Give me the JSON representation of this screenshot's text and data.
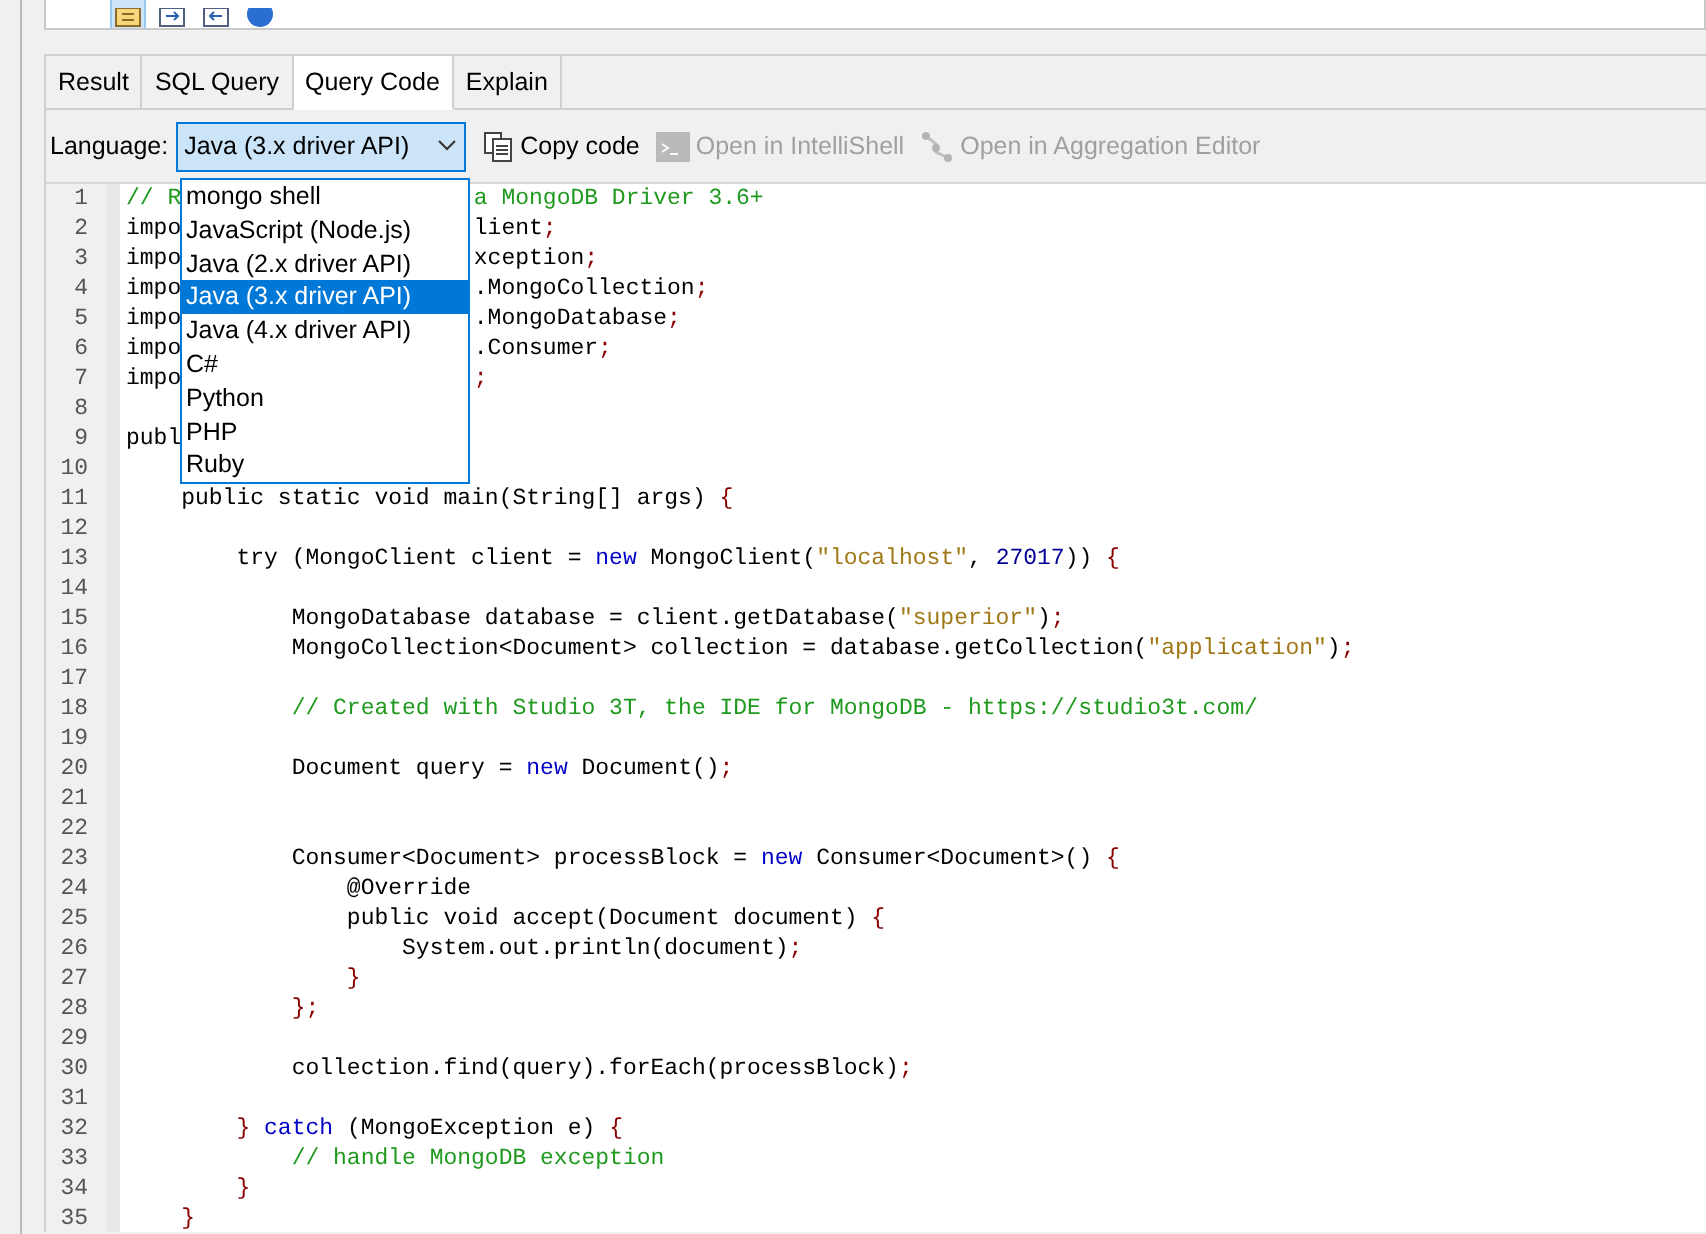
{
  "top_toolbar": {
    "buttons": [
      {
        "selected": true
      },
      {
        "selected": false
      },
      {
        "selected": false
      },
      {
        "selected": false
      }
    ]
  },
  "tabs": [
    {
      "label": "Result",
      "selected": false
    },
    {
      "label": "SQL Query",
      "selected": false
    },
    {
      "label": "Query Code",
      "selected": true
    },
    {
      "label": "Explain",
      "selected": false
    }
  ],
  "language": {
    "label": "Language:",
    "value": "Java (3.x driver API)",
    "expanded": true,
    "options": [
      {
        "label": "mongo shell",
        "selected": false
      },
      {
        "label": "JavaScript (Node.js)",
        "selected": false
      },
      {
        "label": "Java (2.x driver API)",
        "selected": false
      },
      {
        "label": "Java (3.x driver API)",
        "selected": true
      },
      {
        "label": "Java (4.x driver API)",
        "selected": false
      },
      {
        "label": "C#",
        "selected": false
      },
      {
        "label": "Python",
        "selected": false
      },
      {
        "label": "PHP",
        "selected": false
      },
      {
        "label": "Ruby",
        "selected": false
      }
    ]
  },
  "actions": [
    {
      "label": "Copy code",
      "disabled": false
    },
    {
      "label": "Open in IntelliShell",
      "disabled": true
    },
    {
      "label": "Open in Aggregation Editor",
      "disabled": true
    }
  ],
  "code": [
    {
      "number": "1",
      "tokens": [
        {
          "kind": "comment",
          "text": "// R"
        }
      ],
      "right": [
        {
          "kind": "comment",
          "text": "a MongoDB Driver 3.6+"
        }
      ]
    },
    {
      "number": "2",
      "tokens": [
        {
          "kind": "plain",
          "text": "impo"
        }
      ],
      "right": [
        {
          "kind": "plain",
          "text": "lient"
        },
        {
          "kind": "punct",
          "text": ";"
        }
      ]
    },
    {
      "number": "3",
      "tokens": [
        {
          "kind": "plain",
          "text": "impo"
        }
      ],
      "right": [
        {
          "kind": "plain",
          "text": "xception"
        },
        {
          "kind": "punct",
          "text": ";"
        }
      ]
    },
    {
      "number": "4",
      "tokens": [
        {
          "kind": "plain",
          "text": "impo"
        }
      ],
      "right": [
        {
          "kind": "plain",
          "text": ".MongoCollection"
        },
        {
          "kind": "punct",
          "text": ";"
        }
      ]
    },
    {
      "number": "5",
      "tokens": [
        {
          "kind": "plain",
          "text": "impo"
        }
      ],
      "right": [
        {
          "kind": "plain",
          "text": ".MongoDatabase"
        },
        {
          "kind": "punct",
          "text": ";"
        }
      ]
    },
    {
      "number": "6",
      "tokens": [
        {
          "kind": "plain",
          "text": "impo"
        }
      ],
      "right": [
        {
          "kind": "plain",
          "text": ".Consumer"
        },
        {
          "kind": "punct",
          "text": ";"
        }
      ]
    },
    {
      "number": "7",
      "tokens": [
        {
          "kind": "plain",
          "text": "impo"
        }
      ],
      "right": [
        {
          "kind": "punct",
          "text": ";"
        }
      ]
    },
    {
      "number": "8"
    },
    {
      "number": "9",
      "tokens": [
        {
          "kind": "plain",
          "text": "publ"
        }
      ]
    },
    {
      "number": "10"
    },
    {
      "number": "11",
      "tokens": [
        {
          "kind": "plain",
          "text": "    public static void main(String[] args) "
        },
        {
          "kind": "punct",
          "text": "{"
        }
      ]
    },
    {
      "number": "12"
    },
    {
      "number": "13",
      "tokens": [
        {
          "kind": "plain",
          "text": "        try (MongoClient client = "
        },
        {
          "kind": "keyword",
          "text": "new"
        },
        {
          "kind": "plain",
          "text": " MongoClient("
        },
        {
          "kind": "string",
          "text": "\"localhost\""
        },
        {
          "kind": "plain",
          "text": ", "
        },
        {
          "kind": "number",
          "text": "27017"
        },
        {
          "kind": "plain",
          "text": ")) "
        },
        {
          "kind": "punct",
          "text": "{"
        }
      ]
    },
    {
      "number": "14"
    },
    {
      "number": "15",
      "tokens": [
        {
          "kind": "plain",
          "text": "            MongoDatabase database = client.getDatabase("
        },
        {
          "kind": "string",
          "text": "\"superior\""
        },
        {
          "kind": "plain",
          "text": ")"
        },
        {
          "kind": "punct",
          "text": ";"
        }
      ]
    },
    {
      "number": "16",
      "tokens": [
        {
          "kind": "plain",
          "text": "            MongoCollection<Document> collection = database.getCollection("
        },
        {
          "kind": "string",
          "text": "\"application\""
        },
        {
          "kind": "plain",
          "text": ")"
        },
        {
          "kind": "punct",
          "text": ";"
        }
      ]
    },
    {
      "number": "17"
    },
    {
      "number": "18",
      "tokens": [
        {
          "kind": "comment",
          "text": "            // Created with Studio 3T, the IDE for MongoDB - https://studio3t.com/"
        }
      ]
    },
    {
      "number": "19"
    },
    {
      "number": "20",
      "tokens": [
        {
          "kind": "plain",
          "text": "            Document query = "
        },
        {
          "kind": "keyword",
          "text": "new"
        },
        {
          "kind": "plain",
          "text": " Document()"
        },
        {
          "kind": "punct",
          "text": ";"
        }
      ]
    },
    {
      "number": "21"
    },
    {
      "number": "22"
    },
    {
      "number": "23",
      "tokens": [
        {
          "kind": "plain",
          "text": "            Consumer<Document> processBlock = "
        },
        {
          "kind": "keyword",
          "text": "new"
        },
        {
          "kind": "plain",
          "text": " Consumer<Document>() "
        },
        {
          "kind": "punct",
          "text": "{"
        }
      ]
    },
    {
      "number": "24",
      "tokens": [
        {
          "kind": "plain",
          "text": "                @Override"
        }
      ]
    },
    {
      "number": "25",
      "tokens": [
        {
          "kind": "plain",
          "text": "                public void accept(Document document) "
        },
        {
          "kind": "punct",
          "text": "{"
        }
      ]
    },
    {
      "number": "26",
      "tokens": [
        {
          "kind": "plain",
          "text": "                    System.out.println(document)"
        },
        {
          "kind": "punct",
          "text": ";"
        }
      ]
    },
    {
      "number": "27",
      "tokens": [
        {
          "kind": "punct",
          "text": "                }"
        }
      ]
    },
    {
      "number": "28",
      "tokens": [
        {
          "kind": "punct",
          "text": "            };"
        }
      ]
    },
    {
      "number": "29"
    },
    {
      "number": "30",
      "tokens": [
        {
          "kind": "plain",
          "text": "            collection.find(query).forEach(processBlock)"
        },
        {
          "kind": "punct",
          "text": ";"
        }
      ]
    },
    {
      "number": "31"
    },
    {
      "number": "32",
      "tokens": [
        {
          "kind": "punct",
          "text": "        }"
        },
        {
          "kind": "keyword",
          "text": " catch"
        },
        {
          "kind": "plain",
          "text": " (MongoException e) "
        },
        {
          "kind": "punct",
          "text": "{"
        }
      ]
    },
    {
      "number": "33",
      "tokens": [
        {
          "kind": "comment",
          "text": "            // handle MongoDB exception"
        }
      ]
    },
    {
      "number": "34",
      "tokens": [
        {
          "kind": "punct",
          "text": "        }"
        }
      ]
    },
    {
      "number": "35",
      "tokens": [
        {
          "kind": "punct",
          "text": "    }"
        }
      ]
    }
  ]
}
